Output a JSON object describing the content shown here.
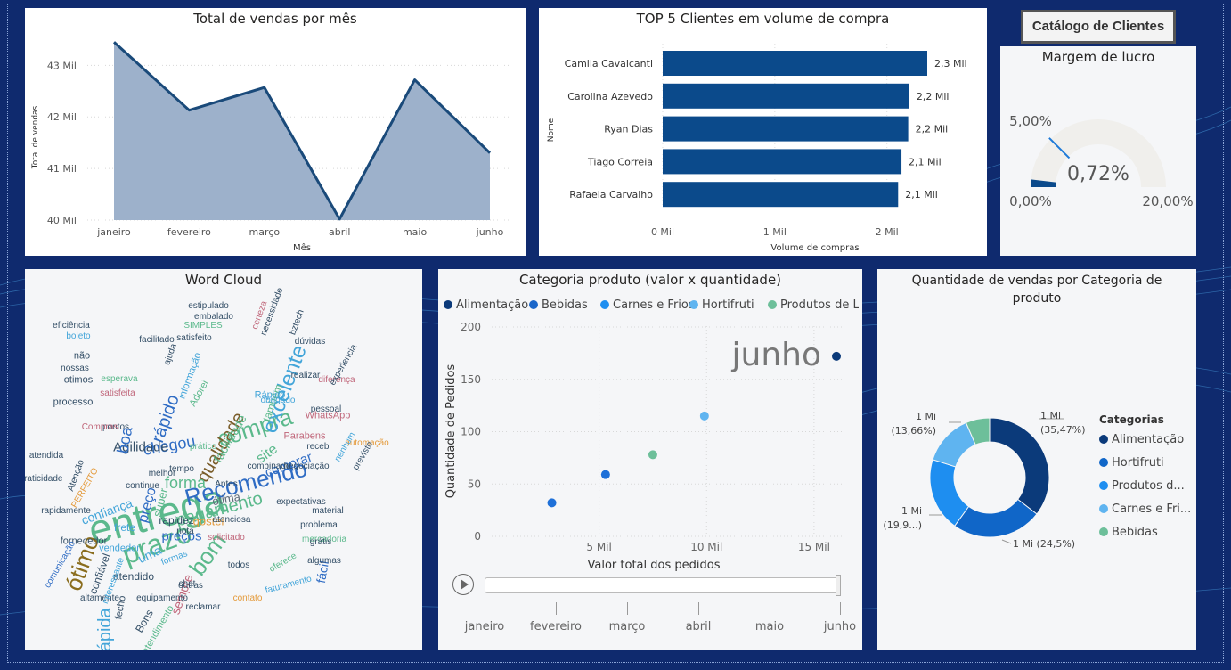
{
  "line_chart": {
    "title": "Total de vendas por mês",
    "xlabel": "Mês",
    "ylabel": "Total de vendas",
    "chart_data": {
      "type": "area",
      "categories": [
        "janeiro",
        "fevereiro",
        "março",
        "abril",
        "maio",
        "junho"
      ],
      "values": [
        43.45,
        42.13,
        42.57,
        40.02,
        42.72,
        41.3
      ],
      "yticks": [
        "40 Mil",
        "41 Mil",
        "42 Mil",
        "43 Mil"
      ],
      "ylim": [
        40,
        43.8
      ],
      "color": "#1a4a7a",
      "fill": "#9db1cb"
    }
  },
  "bar_chart": {
    "title": "TOP 5 Clientes em volume de compra",
    "xlabel": "Volume de compras",
    "ylabel": "Nome",
    "chart_data": {
      "type": "bar",
      "categories": [
        "Camila Cavalcanti",
        "Carolina Azevedo",
        "Ryan Dias",
        "Tiago Correia",
        "Rafaela Carvalho"
      ],
      "values": [
        2.36,
        2.2,
        2.19,
        2.13,
        2.1
      ],
      "labels": [
        "2,3 Mil",
        "2,2 Mil",
        "2,2 Mil",
        "2,1 Mil",
        "2,1 Mil"
      ],
      "xticks": [
        "0 Mil",
        "1 Mil",
        "2 Mil"
      ],
      "xlim": [
        0,
        2.36
      ],
      "color": "#0b4a8b"
    }
  },
  "catalog_button": {
    "label": "Catálogo de Clientes"
  },
  "gauge": {
    "title": "Margem de lucro",
    "value_label": "0,72%",
    "min_label": "0,00%",
    "max_label": "20,00%",
    "target_label": "5,00%",
    "value": 0.72,
    "min": 0,
    "max": 20,
    "target": 5,
    "fill_color": "#0b4a8b",
    "track_color": "#f0efec"
  },
  "wordcloud": {
    "title": "Word Cloud",
    "words": [
      {
        "t": "entrega",
        "c": "#5bb98c"
      },
      {
        "t": "Recomendo",
        "c": "#2f6cc4"
      },
      {
        "t": "prazo",
        "c": "#5bb98c"
      },
      {
        "t": "compra",
        "c": "#5bb98c"
      },
      {
        "t": "excelente",
        "c": "#43a5d9"
      },
      {
        "t": "Rápida",
        "c": "#43a5d9"
      },
      {
        "t": "bom",
        "c": "#5bb98c"
      },
      {
        "t": "ótimo",
        "c": "#8a6d1e"
      },
      {
        "t": "qualidade",
        "c": "#7a5d2a"
      },
      {
        "t": "pagamento",
        "c": "#5bb98c"
      },
      {
        "t": "chegou",
        "c": "#2f6cc4"
      },
      {
        "t": "rápido",
        "c": "#2f6cc4"
      },
      {
        "t": "Agilidade",
        "c": "#334e66"
      },
      {
        "t": "preço",
        "c": "#2f6cc4"
      },
      {
        "t": "site",
        "c": "#5bb98c"
      },
      {
        "t": "comprar",
        "c": "#2f6cc4"
      },
      {
        "t": "forma",
        "c": "#5bb98c"
      },
      {
        "t": "preços",
        "c": "#2f6cc4"
      },
      {
        "t": "confiança",
        "c": "#43a5d9"
      },
      {
        "t": "facilidade",
        "c": "#5bb98c"
      },
      {
        "t": "boa",
        "c": "#2f6cc4"
      },
      {
        "t": "frete",
        "c": "#43a5d9"
      },
      {
        "t": "rapidez",
        "c": "#334e66"
      },
      {
        "t": "sempre",
        "c": "#c0667a"
      },
      {
        "t": "fácil",
        "c": "#2f6cc4"
      },
      {
        "t": "uma",
        "c": "#43a5d9"
      },
      {
        "t": "ótima",
        "c": "#5c6a78"
      },
      {
        "t": "super",
        "c": "#5bb98c"
      },
      {
        "t": "gostei",
        "c": "#e49a3a"
      },
      {
        "t": "atendido",
        "c": "#334e66"
      },
      {
        "t": "também",
        "c": "#5bb98c"
      },
      {
        "t": "muita",
        "c": "#8a70c8"
      },
      {
        "t": "vendedor",
        "c": "#43a5d9"
      },
      {
        "t": "fornecedor",
        "c": "#334e66"
      },
      {
        "t": "Parabens",
        "c": "#c0667a"
      },
      {
        "t": "fecho",
        "c": "#334e66"
      },
      {
        "t": "Rápido",
        "c": "#43a5d9"
      },
      {
        "t": "Bons",
        "c": "#334e66"
      },
      {
        "t": "atendimento",
        "c": "#5bb98c"
      },
      {
        "t": "confiável",
        "c": "#334e66"
      },
      {
        "t": "WhatsApp",
        "c": "#c0667a"
      },
      {
        "t": "eficiência",
        "c": "#334e66"
      },
      {
        "t": "boleto",
        "c": "#43a5d9"
      },
      {
        "t": "não",
        "c": "#334e66"
      },
      {
        "t": "nossas",
        "c": "#334e66"
      },
      {
        "t": "diferença",
        "c": "#c0667a"
      },
      {
        "t": "processo",
        "c": "#334e66"
      },
      {
        "t": "otimos",
        "c": "#334e66"
      },
      {
        "t": "material",
        "c": "#334e66"
      },
      {
        "t": "problema",
        "c": "#334e66"
      },
      {
        "t": "mercadoria",
        "c": "#5bb98c"
      },
      {
        "t": "algumas",
        "c": "#334e66"
      },
      {
        "t": "faturamento",
        "c": "#43a5d9"
      },
      {
        "t": "oferece",
        "c": "#5bb98c"
      },
      {
        "t": "contato",
        "c": "#e49a3a"
      },
      {
        "t": "reclamar",
        "c": "#334e66"
      },
      {
        "t": "equipamento",
        "c": "#334e66"
      },
      {
        "t": "outras",
        "c": "#334e66"
      },
      {
        "t": "formas",
        "c": "#43a5d9"
      },
      {
        "t": "altamente",
        "c": "#334e66"
      },
      {
        "t": "interessante",
        "c": "#43a5d9"
      },
      {
        "t": "comunicação",
        "c": "#2f6cc4"
      },
      {
        "t": "rapidamente",
        "c": "#334e66"
      },
      {
        "t": "praticidade",
        "c": "#334e66"
      },
      {
        "t": "atendida",
        "c": "#334e66"
      },
      {
        "t": "combinado",
        "c": "#334e66"
      },
      {
        "t": "negociação",
        "c": "#334e66"
      },
      {
        "t": "expectativas",
        "c": "#334e66"
      },
      {
        "t": "solicitado",
        "c": "#c0667a"
      },
      {
        "t": "atenciosa",
        "c": "#334e66"
      },
      {
        "t": "estipulado",
        "c": "#334e66"
      },
      {
        "t": "embalado",
        "c": "#334e66"
      },
      {
        "t": "SIMPLES",
        "c": "#5bb98c"
      },
      {
        "t": "satisfeito",
        "c": "#334e66"
      },
      {
        "t": "experiencia",
        "c": "#334e66"
      },
      {
        "t": "automação",
        "c": "#e49a3a"
      },
      {
        "t": "previsto",
        "c": "#334e66"
      },
      {
        "t": "nenhum",
        "c": "#43a5d9"
      },
      {
        "t": "pessoal",
        "c": "#334e66"
      },
      {
        "t": "realizar",
        "c": "#334e66"
      },
      {
        "t": "dúvidas",
        "c": "#334e66"
      },
      {
        "t": "bztech",
        "c": "#334e66"
      },
      {
        "t": "necessidade",
        "c": "#334e66"
      },
      {
        "t": "certeza",
        "c": "#c0667a"
      },
      {
        "t": "facilitado",
        "c": "#334e66"
      },
      {
        "t": "ajuda",
        "c": "#334e66"
      },
      {
        "t": "Adorei",
        "c": "#5bb98c"
      },
      {
        "t": "informação",
        "c": "#43a5d9"
      },
      {
        "t": "obrigado",
        "c": "#43a5d9"
      },
      {
        "t": "pontos",
        "c": "#334e66"
      },
      {
        "t": "Compras",
        "c": "#c0667a"
      },
      {
        "t": "Atenção",
        "c": "#334e66"
      },
      {
        "t": "PERFEITO",
        "c": "#e49a3a"
      },
      {
        "t": "satisfeita",
        "c": "#c0667a"
      },
      {
        "t": "esperava",
        "c": "#5bb98c"
      },
      {
        "t": "continue",
        "c": "#334e66"
      },
      {
        "t": "melhor",
        "c": "#334e66"
      },
      {
        "t": "tempo",
        "c": "#334e66"
      },
      {
        "t": "recebi",
        "c": "#334e66"
      },
      {
        "t": "Antes",
        "c": "#334e66"
      },
      {
        "t": "nota",
        "c": "#334e66"
      },
      {
        "t": "chat",
        "c": "#334e66"
      },
      {
        "t": "todos",
        "c": "#334e66"
      },
      {
        "t": "grátis",
        "c": "#334e66"
      },
      {
        "t": "prático",
        "c": "#5bb98c"
      }
    ]
  },
  "scatter": {
    "title": "Categoria produto (valor x quantidade)",
    "xlabel": "Valor total dos pedidos",
    "ylabel": "Quantidade de Pedidos",
    "month_label": "junho",
    "legend": [
      {
        "name": "Alimentação",
        "color": "#0b3a7a"
      },
      {
        "name": "Bebidas",
        "color": "#1a66c9"
      },
      {
        "name": "Carnes e Frios",
        "color": "#1e8ef0"
      },
      {
        "name": "Hortifruti",
        "color": "#5fb4f0"
      },
      {
        "name": "Produtos de Li...",
        "color": "#6dbf9a"
      }
    ],
    "chart_data": {
      "type": "scatter",
      "xlim": [
        0,
        16
      ],
      "ylim": [
        0,
        200
      ],
      "xticks": [
        {
          "v": 5,
          "l": "5 Mil"
        },
        {
          "v": 10,
          "l": "10 Mil"
        },
        {
          "v": 15,
          "l": "15 Mil"
        }
      ],
      "yticks": [
        0,
        50,
        100,
        150,
        200
      ],
      "points": [
        {
          "x": 2.8,
          "y": 32,
          "color": "#1e70d8"
        },
        {
          "x": 5.3,
          "y": 59,
          "color": "#1e70d8"
        },
        {
          "x": 7.5,
          "y": 78,
          "color": "#6dbf9a"
        },
        {
          "x": 9.9,
          "y": 115,
          "color": "#5fb4f0"
        },
        {
          "x": 16.2,
          "y": 172,
          "color": "#0b3a7a"
        }
      ]
    },
    "timeline": [
      "janeiro",
      "fevereiro",
      "março",
      "abril",
      "maio",
      "junho"
    ]
  },
  "donut": {
    "title": "Quantidade de vendas por Categoria de produto",
    "legend_title": "Categorias",
    "chart_data": {
      "type": "pie",
      "slices": [
        {
          "name": "Alimentação",
          "value": 35.47,
          "color": "#0b3a7a",
          "label1": "1 Mi",
          "label2": "(35,47%)"
        },
        {
          "name": "Hortifruti",
          "value": 24.5,
          "color": "#1066c8",
          "label1": "1 Mi (24,5%)",
          "label2": ""
        },
        {
          "name": "Produtos d...",
          "value": 19.9,
          "color": "#1e8ef0",
          "label1": "1 Mi",
          "label2": "(19,9...)"
        },
        {
          "name": "Carnes e Fri...",
          "value": 13.66,
          "color": "#5fb4f0",
          "label1": "1 Mi",
          "label2": "(13,66%)"
        },
        {
          "name": "Bebidas",
          "value": 6.47,
          "color": "#6dbf9a",
          "label1": "",
          "label2": ""
        }
      ]
    }
  }
}
